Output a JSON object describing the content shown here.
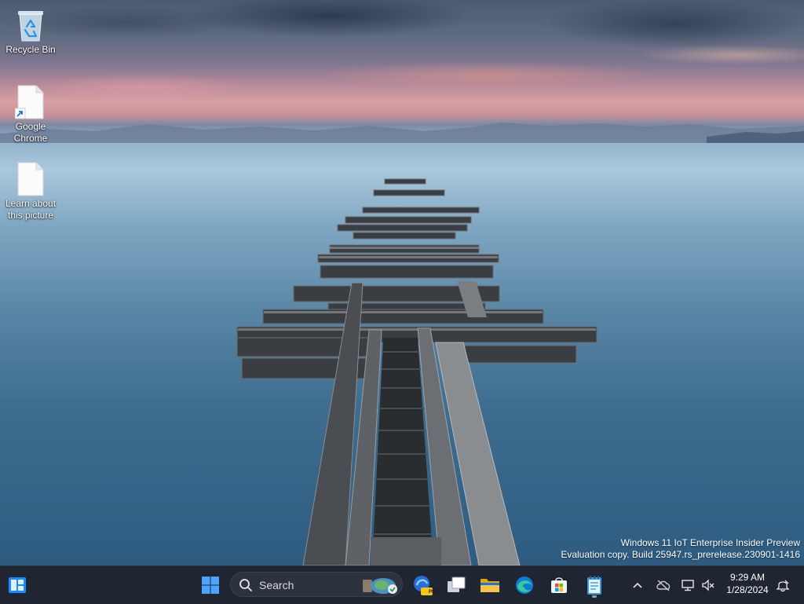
{
  "desktop": {
    "icons": [
      {
        "label": "Recycle Bin",
        "icon": "recycle-bin-icon"
      },
      {
        "label": "Google Chrome",
        "icon": "shortcut-file-icon"
      },
      {
        "label": "Learn about this picture",
        "icon": "file-icon"
      }
    ],
    "watermark": {
      "line1": "Windows 11 IoT Enterprise Insider Preview",
      "line2": "Evaluation copy. Build 25947.rs_prerelease.230901-1416"
    }
  },
  "taskbar": {
    "search": {
      "placeholder": "Search"
    },
    "pinned": [
      {
        "name": "widgets",
        "icon": "widgets-icon"
      },
      {
        "name": "start",
        "icon": "windows-logo-icon"
      },
      {
        "name": "copilot",
        "icon": "copilot-pre-icon",
        "badge": "PRE"
      },
      {
        "name": "task-view",
        "icon": "task-view-icon"
      },
      {
        "name": "file-explorer",
        "icon": "folder-icon"
      },
      {
        "name": "edge",
        "icon": "edge-icon"
      },
      {
        "name": "store",
        "icon": "store-icon"
      },
      {
        "name": "notepad",
        "icon": "notepad-icon"
      }
    ],
    "tray": {
      "time": "9:29 AM",
      "date": "1/28/2024"
    }
  },
  "colors": {
    "taskbar_bg": "#1f2631",
    "accent_blue": "#4aa3ff",
    "folder_yellow": "#f4c542"
  }
}
